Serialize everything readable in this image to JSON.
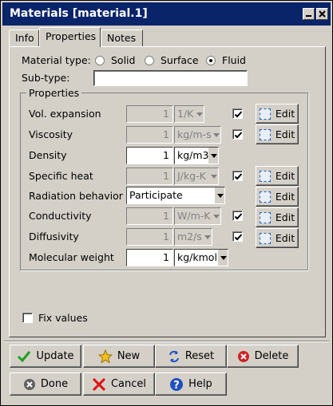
{
  "window": {
    "title": "Materials [material.1]"
  },
  "tabs": [
    {
      "label": "Info"
    },
    {
      "label": "Properties",
      "active": true
    },
    {
      "label": "Notes"
    }
  ],
  "material_type": {
    "label": "Material type:",
    "options": [
      {
        "label": "Solid",
        "checked": false
      },
      {
        "label": "Surface",
        "checked": false
      },
      {
        "label": "Fluid",
        "checked": true
      }
    ]
  },
  "subtype": {
    "label": "Sub-type:",
    "value": ""
  },
  "properties": {
    "group_label": "Properties",
    "rows": [
      {
        "label": "Vol. expansion",
        "value": "1",
        "unit": "1/K",
        "enabled": false,
        "checked": true,
        "edit": "Edit"
      },
      {
        "label": "Viscosity",
        "value": "1",
        "unit": "kg/m-s",
        "enabled": false,
        "checked": true,
        "edit": "Edit"
      },
      {
        "label": "Density",
        "value": "1",
        "unit": "kg/m3",
        "enabled": true,
        "checked": false,
        "edit": ""
      },
      {
        "label": "Specific heat",
        "value": "1",
        "unit": "J/kg-K",
        "enabled": false,
        "checked": true,
        "edit": "Edit"
      },
      {
        "label": "Radiation behavior",
        "select": "Participate",
        "edit": "Edit"
      },
      {
        "label": "Conductivity",
        "value": "1",
        "unit": "W/m-K",
        "enabled": false,
        "checked": true,
        "edit": "Edit"
      },
      {
        "label": "Diffusivity",
        "value": "1",
        "unit": "m2/s",
        "enabled": false,
        "checked": true,
        "edit": "Edit"
      },
      {
        "label": "Molecular weight",
        "value": "1",
        "unit": "kg/kmol",
        "enabled": true,
        "checked": false,
        "edit": ""
      }
    ]
  },
  "fix_values": {
    "label": "Fix values",
    "checked": false
  },
  "buttons": {
    "update": "Update",
    "new": "New",
    "reset": "Reset",
    "delete": "Delete",
    "done": "Done",
    "cancel": "Cancel",
    "help": "Help"
  },
  "colors": {
    "titlebar": "#0a246a",
    "face": "#d4d0c8",
    "delete_icon": "#d02020",
    "help_icon": "#2050c0",
    "update_icon": "#20a020",
    "new_icon": "#f0c020"
  }
}
